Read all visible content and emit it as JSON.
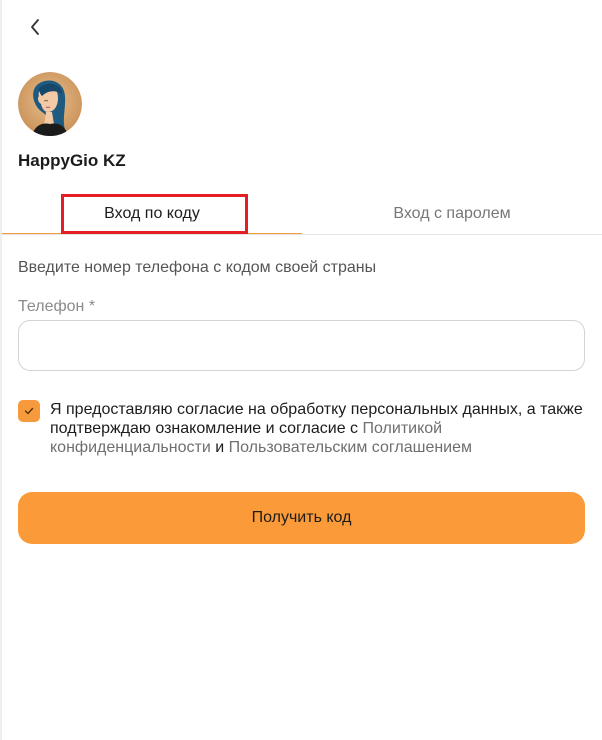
{
  "header": {
    "back_icon": "chevron-left-icon"
  },
  "brand": {
    "name": "HappyGio KZ",
    "avatar_colors": {
      "ring": "#d9a56b",
      "hair": "#1f5a80",
      "skin": "#f3c9a6"
    }
  },
  "tabs": [
    {
      "label": "Вход по коду",
      "active": true
    },
    {
      "label": "Вход с паролем",
      "active": false
    }
  ],
  "form": {
    "instruction": "Введите номер телефона с кодом своей страны",
    "phone_label": "Телефон *",
    "phone_value": "",
    "phone_placeholder": ""
  },
  "consent": {
    "checked": true,
    "text_part1": "Я предоставляю согласие на обработку персональных данных, а также подтверждаю ознакомление и согласие с ",
    "privacy_link": "Политикой конфиденциальности",
    "conjunction": " и ",
    "terms_link": "Пользовательским соглашением"
  },
  "submit": {
    "label": "Получить код"
  },
  "colors": {
    "accent": "#f79a3e",
    "button": "#fb9a38",
    "highlight": "#e31e24"
  }
}
